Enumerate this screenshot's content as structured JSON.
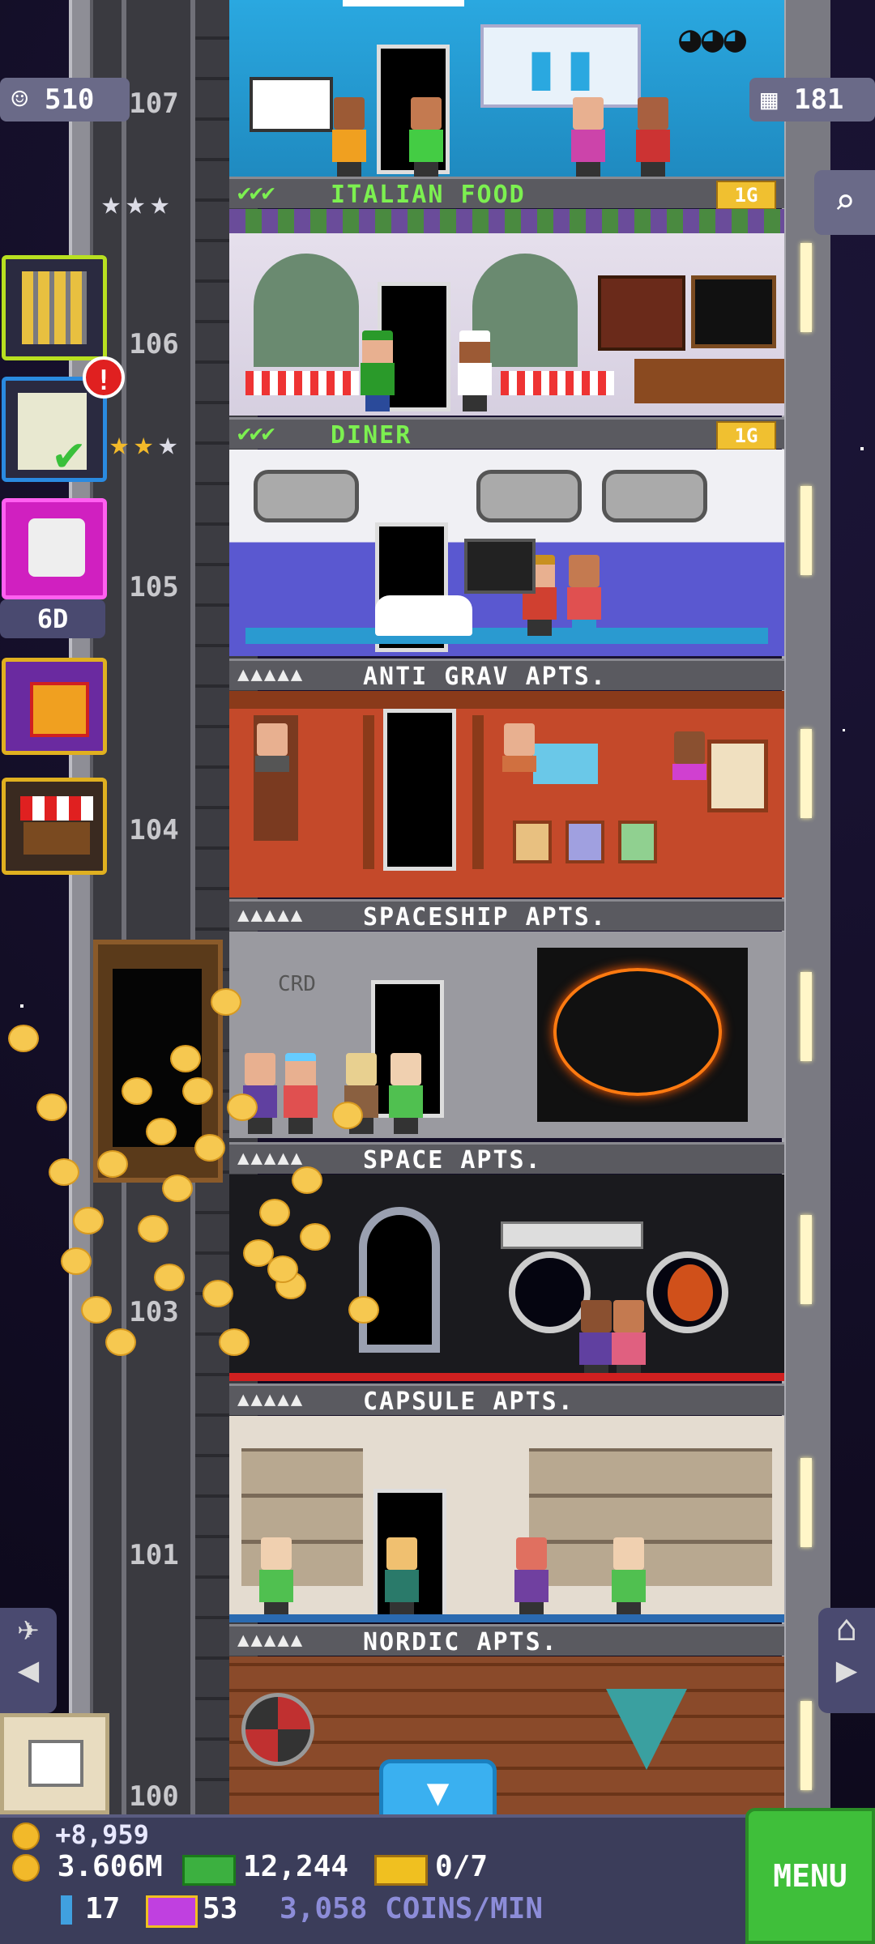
{
  "hud": {
    "population": "510",
    "floors": "181",
    "dice_timer": "6D",
    "alert_badge": "!"
  },
  "floor_numbers": [
    "107",
    "106",
    "105",
    "104",
    "103",
    "101",
    "100"
  ],
  "floors": [
    {
      "name": "ITALIAN FOOD",
      "type": "business",
      "checks": "✔✔✔",
      "level": "1G"
    },
    {
      "name": "DINER",
      "type": "business",
      "checks": "✔✔✔",
      "level": "1G"
    },
    {
      "name": "ANTI GRAV APTS.",
      "type": "residential"
    },
    {
      "name": "SPACESHIP APTS.",
      "type": "residential"
    },
    {
      "name": "SPACE APTS.",
      "type": "residential"
    },
    {
      "name": "CAPSULE APTS.",
      "type": "residential"
    },
    {
      "name": "NORDIC APTS.",
      "type": "residential"
    }
  ],
  "residential_stars": "▲▲▲▲▲",
  "bottom": {
    "coins_gain": "+8,959",
    "coins_total": "3.606M",
    "bux": "12,244",
    "tickets": "0/7",
    "keys": "17",
    "vip": "53",
    "rate": "3,058 COINS/MIN",
    "menu_label": "MENU"
  },
  "colors": {
    "accent_green": "#7cf050",
    "gold": "#f2b92a",
    "menu_green": "#3fbf3a"
  },
  "icons": [
    "person-icon",
    "building-icon",
    "search-icon",
    "checklist-icon",
    "dice-icon",
    "gift-icon",
    "market-icon",
    "plane-icon",
    "home-icon",
    "down-arrow-icon",
    "box-icon"
  ]
}
